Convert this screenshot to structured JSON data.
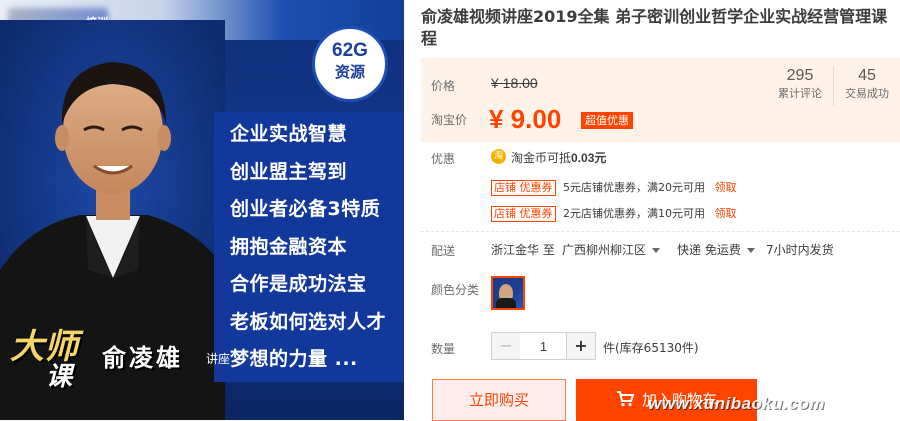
{
  "product": {
    "title": "俞凌雄视频讲座2019全集 弟子密训创业哲学企业实战经营管理课程"
  },
  "image": {
    "logo_text": "培训",
    "badge_line1": "62G",
    "badge_line2": "资源",
    "features": [
      "企业实战智慧",
      "创业盟主驾到",
      "创业者必备3特质",
      "拥抱金融资本",
      "合作是成功法宝",
      "老板如何选对人才",
      "梦想的力量 ..."
    ],
    "sig_master": "大师",
    "sig_course": "课",
    "sig_name": "俞凌雄",
    "sig_lecture": "讲座"
  },
  "price": {
    "label": "价格",
    "original": "¥ 18.00",
    "promo_label": "淘宝价",
    "current": "¥ 9.00",
    "promo_tag": "超值优惠"
  },
  "stats": [
    {
      "value": "295",
      "label": "累计评论"
    },
    {
      "value": "45",
      "label": "交易成功"
    }
  ],
  "discount": {
    "label": "优惠",
    "coin_icon": "淘",
    "coin_text_prefix": "淘金币可抵",
    "coin_amount": "0.03元",
    "coupons": [
      {
        "tag": "店铺 优惠券",
        "desc": "5元店铺优惠券，满20元可用",
        "claim": "领取"
      },
      {
        "tag": "店铺 优惠券",
        "desc": "2元店铺优惠券，满10元可用",
        "claim": "领取"
      }
    ]
  },
  "shipping": {
    "label": "配送",
    "origin": "浙江金华 至",
    "destination": "广西柳州柳江区",
    "method": "快递 免运费",
    "dispatch": "7小时内发货"
  },
  "variant": {
    "label": "颜色分类"
  },
  "quantity": {
    "label": "数量",
    "value": "1",
    "minus": "−",
    "plus": "+",
    "stock": "件(库存65130件)"
  },
  "actions": {
    "buy_now": "立即购买",
    "add_to_cart": "加入购物车"
  },
  "watermark": "www.xunibaoku.com",
  "colors": {
    "accent": "#ff4400",
    "price_bg": "#fff2e8",
    "banner_blue": "#12389b"
  }
}
